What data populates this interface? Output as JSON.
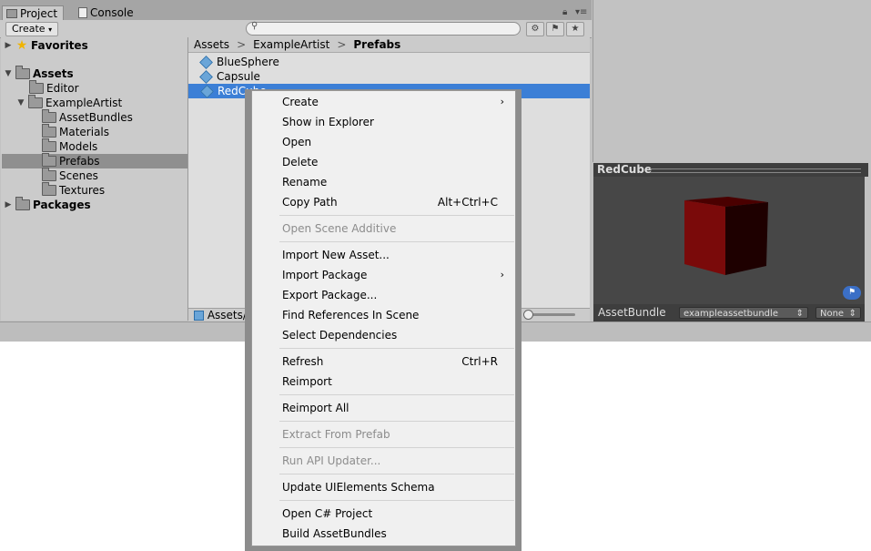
{
  "tabs": {
    "project": "Project",
    "console": "Console"
  },
  "toolbar": {
    "create": "Create"
  },
  "tree": {
    "favorites": "Favorites",
    "assets": "Assets",
    "editor": "Editor",
    "exampleartist": "ExampleArtist",
    "assetbundles": "AssetBundles",
    "materials": "Materials",
    "models": "Models",
    "prefabs": "Prefabs",
    "scenes": "Scenes",
    "textures": "Textures",
    "packages": "Packages"
  },
  "breadcrumb": {
    "c1": "Assets",
    "c2": "ExampleArtist",
    "c3": "Prefabs",
    "sep": ">"
  },
  "assets": [
    "BlueSphere",
    "Capsule",
    "RedCube"
  ],
  "status": {
    "path": "Assets/E"
  },
  "preview": {
    "title": "RedCube",
    "assetbundle_label": "AssetBundle",
    "bundle_value": "exampleassetbundle",
    "variant_value": "None",
    "cube_color": "#7a0a0a"
  },
  "menu": {
    "create": "Create",
    "show_in_explorer": "Show in Explorer",
    "open": "Open",
    "delete": "Delete",
    "rename": "Rename",
    "copy_path": "Copy Path",
    "copy_path_sc": "Alt+Ctrl+C",
    "open_scene_additive": "Open Scene Additive",
    "import_new_asset": "Import New Asset...",
    "import_package": "Import Package",
    "export_package": "Export Package...",
    "find_references": "Find References In Scene",
    "select_dependencies": "Select Dependencies",
    "refresh": "Refresh",
    "refresh_sc": "Ctrl+R",
    "reimport": "Reimport",
    "reimport_all": "Reimport All",
    "extract_from_prefab": "Extract From Prefab",
    "run_api_updater": "Run API Updater...",
    "update_uielements": "Update UIElements Schema",
    "open_csharp": "Open C# Project",
    "build_assetbundles": "Build AssetBundles"
  }
}
